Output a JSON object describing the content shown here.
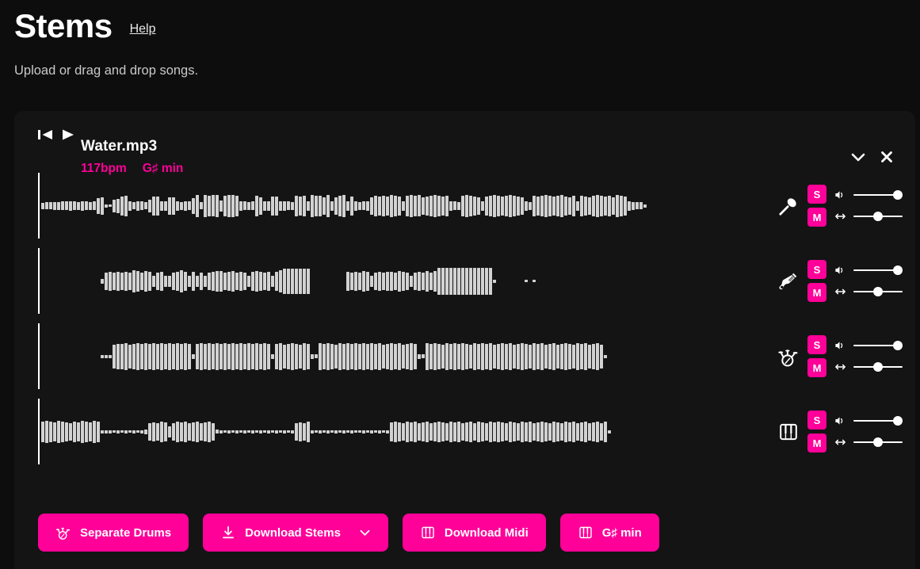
{
  "header": {
    "app_title": "Stems",
    "help_label": "Help",
    "subtitle": "Upload or drag and drop songs."
  },
  "colors": {
    "accent": "#ff0099",
    "page_bg": "#0d0d0d",
    "card_bg": "#141414",
    "waveform": "#d2d2d2",
    "text": "#ffffff"
  },
  "track": {
    "name": "Water.mp3",
    "bpm": "117bpm",
    "key": "G♯ min",
    "transport": {
      "skip_start": "skip-to-start-icon",
      "play": "play-icon"
    },
    "actions": {
      "collapse": "chevron-down-icon",
      "close": "close-icon"
    }
  },
  "stems": [
    {
      "name": "vocals",
      "icon": "microphone-icon",
      "solo_label": "S",
      "mute_label": "M",
      "volume_icon": "volume-icon",
      "volume_value": 100,
      "pan_icon": "pan-icon",
      "pan_value": 50,
      "bars": [
        8,
        9,
        9,
        10,
        10,
        11,
        11,
        12,
        11,
        10,
        12,
        11,
        10,
        11,
        20,
        22,
        4,
        3,
        16,
        18,
        24,
        26,
        12,
        9,
        12,
        11,
        9,
        16,
        24,
        24,
        12,
        12,
        22,
        22,
        12,
        10,
        12,
        11,
        20,
        28,
        9,
        28,
        26,
        27,
        28,
        14,
        26,
        28,
        28,
        26,
        12,
        11,
        10,
        11,
        26,
        22,
        12,
        12,
        24,
        24,
        12,
        12,
        11,
        10,
        26,
        24,
        26,
        12,
        28,
        26,
        26,
        22,
        28,
        12,
        22,
        26,
        28,
        12,
        24,
        12,
        10,
        11,
        12,
        22,
        26,
        24,
        26,
        24,
        28,
        26,
        24,
        12,
        26,
        28,
        26,
        27,
        22,
        24,
        26,
        28,
        26,
        24,
        26,
        12,
        11,
        10,
        26,
        28,
        26,
        24,
        22,
        12,
        24,
        26,
        28,
        26,
        24,
        26,
        28,
        26,
        24,
        22,
        12,
        10,
        26,
        24,
        26,
        28,
        26,
        24,
        26,
        28,
        24,
        22,
        26,
        12,
        26,
        24,
        22,
        26,
        28,
        26,
        24,
        26,
        22,
        28,
        26,
        24,
        12,
        10,
        9,
        9,
        4
      ],
      "gap_start": 0
    },
    {
      "name": "bass",
      "icon": "guitar-icon",
      "solo_label": "S",
      "mute_label": "M",
      "volume_icon": "volume-icon",
      "volume_value": 100,
      "pan_icon": "pan-icon",
      "pan_value": 50,
      "bars": [
        0,
        0,
        0,
        0,
        0,
        0,
        0,
        0,
        0,
        0,
        0,
        0,
        0,
        0,
        0,
        6,
        22,
        24,
        22,
        24,
        22,
        24,
        22,
        28,
        26,
        22,
        26,
        24,
        14,
        22,
        24,
        14,
        14,
        22,
        24,
        28,
        24,
        14,
        24,
        14,
        22,
        14,
        22,
        24,
        26,
        26,
        22,
        24,
        26,
        22,
        24,
        22,
        14,
        24,
        26,
        24,
        22,
        24,
        14,
        24,
        28,
        32,
        32,
        32,
        32,
        32,
        32,
        32,
        0,
        0,
        0,
        0,
        0,
        0,
        0,
        0,
        0,
        24,
        22,
        24,
        22,
        26,
        24,
        14,
        22,
        24,
        22,
        24,
        24,
        22,
        26,
        24,
        22,
        14,
        22,
        24,
        22,
        26,
        22,
        26,
        34,
        34,
        34,
        34,
        34,
        34,
        34,
        34,
        34,
        34,
        34,
        34,
        34,
        34,
        4,
        0,
        0,
        0,
        0,
        0,
        0,
        0,
        3,
        0,
        3,
        0,
        0,
        0,
        0,
        0,
        0,
        0,
        0,
        0,
        0,
        0,
        0,
        0,
        0,
        0,
        0,
        0,
        0,
        0,
        0,
        0,
        0,
        0,
        0,
        0,
        0,
        0,
        0,
        0
      ],
      "gap_start": 15
    },
    {
      "name": "drums",
      "icon": "drums-icon",
      "solo_label": "S",
      "mute_label": "M",
      "volume_icon": "volume-icon",
      "volume_value": 100,
      "pan_icon": "pan-icon",
      "pan_value": 50,
      "bars": [
        0,
        0,
        0,
        0,
        0,
        0,
        0,
        0,
        0,
        0,
        0,
        0,
        0,
        0,
        0,
        4,
        4,
        4,
        30,
        32,
        32,
        34,
        30,
        32,
        34,
        32,
        34,
        32,
        34,
        32,
        34,
        32,
        34,
        32,
        34,
        32,
        34,
        32,
        6,
        32,
        34,
        32,
        34,
        32,
        34,
        32,
        34,
        32,
        34,
        32,
        34,
        32,
        34,
        32,
        34,
        32,
        34,
        32,
        6,
        32,
        34,
        30,
        32,
        34,
        32,
        30,
        34,
        32,
        6,
        5,
        34,
        32,
        34,
        32,
        30,
        34,
        32,
        34,
        32,
        34,
        32,
        34,
        32,
        34,
        32,
        34,
        30,
        32,
        34,
        32,
        34,
        30,
        32,
        34,
        32,
        6,
        5,
        34,
        32,
        34,
        32,
        30,
        34,
        32,
        34,
        32,
        34,
        32,
        30,
        34,
        32,
        34,
        32,
        34,
        30,
        32,
        34,
        32,
        34,
        30,
        32,
        34,
        32,
        30,
        34,
        32,
        34,
        30,
        32,
        34,
        30,
        32,
        34,
        32,
        30,
        34,
        32,
        34,
        30,
        32,
        34,
        30,
        4,
        0,
        0,
        0,
        0,
        0,
        0,
        0
      ],
      "gap_start": 15
    },
    {
      "name": "keys",
      "icon": "piano-icon",
      "solo_label": "S",
      "mute_label": "M",
      "volume_icon": "volume-icon",
      "volume_value": 100,
      "pan_icon": "pan-icon",
      "pan_value": 50,
      "bars": [
        26,
        28,
        26,
        24,
        28,
        26,
        24,
        22,
        26,
        24,
        28,
        26,
        24,
        28,
        26,
        4,
        4,
        4,
        3,
        4,
        3,
        4,
        3,
        4,
        3,
        4,
        6,
        22,
        24,
        22,
        26,
        24,
        14,
        22,
        26,
        24,
        26,
        22,
        24,
        26,
        22,
        24,
        26,
        22,
        5,
        4,
        3,
        4,
        3,
        4,
        3,
        4,
        3,
        4,
        3,
        4,
        3,
        4,
        3,
        4,
        3,
        4,
        3,
        4,
        22,
        24,
        22,
        26,
        4,
        3,
        4,
        3,
        4,
        3,
        4,
        3,
        4,
        3,
        4,
        3,
        3,
        4,
        3,
        4,
        3,
        4,
        3,
        4,
        24,
        26,
        24,
        22,
        26,
        24,
        26,
        22,
        24,
        26,
        22,
        24,
        26,
        24,
        22,
        26,
        24,
        26,
        22,
        24,
        26,
        22,
        26,
        24,
        22,
        26,
        24,
        26,
        24,
        22,
        26,
        24,
        22,
        26,
        24,
        26,
        22,
        24,
        26,
        24,
        22,
        26,
        24,
        22,
        26,
        24,
        26,
        22,
        24,
        26,
        22,
        24,
        26,
        22,
        26,
        4
      ],
      "gap_start": 0
    }
  ],
  "footer_buttons": [
    {
      "label": "Separate Drums",
      "icon": "drums-icon",
      "has_chevron": false
    },
    {
      "label": "Download Stems",
      "icon": "download-icon",
      "has_chevron": true
    },
    {
      "label": "Download Midi",
      "icon": "piano-icon",
      "has_chevron": false
    },
    {
      "label": "G♯ min",
      "icon": "piano-icon",
      "has_chevron": false
    }
  ]
}
